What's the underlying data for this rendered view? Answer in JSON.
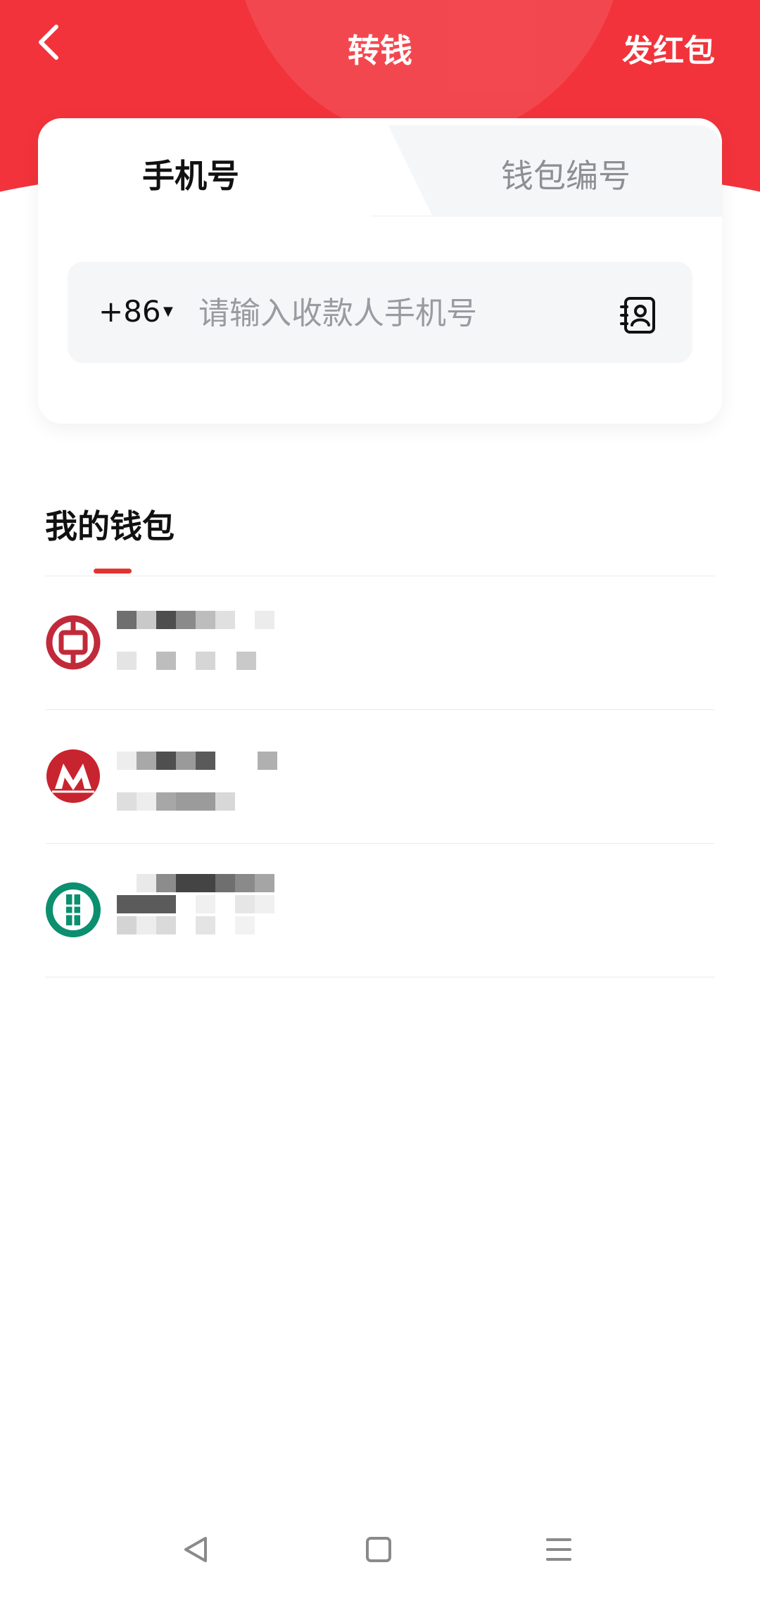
{
  "header": {
    "title": "转钱",
    "red_packet_label": "发红包",
    "background_color": "#f2333b"
  },
  "tabs": [
    {
      "label": "手机号",
      "active": true
    },
    {
      "label": "钱包编号",
      "active": false
    }
  ],
  "phone_input": {
    "country_code": "+86",
    "placeholder": "请输入收款人手机号",
    "value": ""
  },
  "wallets": {
    "title": "我的钱包",
    "accent_color": "#e2342f",
    "items": [
      {
        "logo": "bank-of-china-logo",
        "color": "#c12a3a"
      },
      {
        "logo": "china-merchants-bank-logo",
        "color": "#c8242f"
      },
      {
        "logo": "agricultural-bank-logo",
        "color": "#0b8f6f"
      }
    ]
  },
  "icons": {
    "back": "chevron-left-icon",
    "contacts": "contact-book-icon",
    "nav_back": "triangle-back-icon",
    "nav_home": "square-home-icon",
    "nav_menu": "menu-lines-icon"
  }
}
